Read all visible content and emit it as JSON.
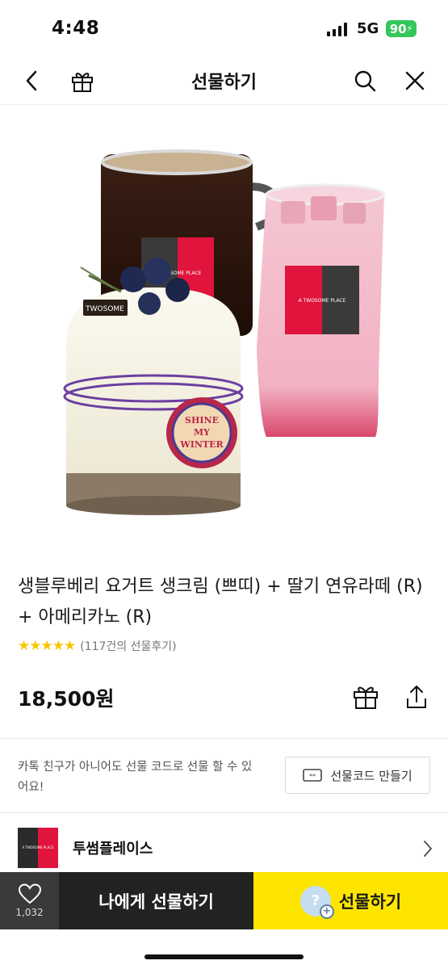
{
  "status_bar": {
    "time": "4:48",
    "network": "5G",
    "battery": "90"
  },
  "header": {
    "title": "선물하기"
  },
  "product": {
    "image_labels": {
      "brand_sign_mug": "A TWOSOME PLACE",
      "brand_sign_glass": "A TWOSOME PLACE",
      "cake_tag": "TWOSOME",
      "badge_line1": "SHINE",
      "badge_line2": "MY",
      "badge_line3": "WINTER"
    },
    "title": "생블루베리 요거트 생크림 (쁘띠) + 딸기 연유라떼 (R) + 아메리카노 (R)",
    "stars": "★★★★★",
    "rating_count": "(117건의 선물후기)",
    "price": "18,500원"
  },
  "gift_code": {
    "info": "카톡 친구가 아니어도 선물 코드로 선물 할 수 있어요!",
    "button": "선물코드 만들기"
  },
  "brand": {
    "logo_text": "A TWOSOME PLACE",
    "name": "투썸플레이스"
  },
  "bottom_bar": {
    "like_count": "1,032",
    "self_gift": "나에게 선물하기",
    "gift": "선물하기",
    "gift_icon_glyph": "?",
    "gift_icon_plus": "+"
  },
  "colors": {
    "gift_button": "#fee500",
    "dark_button": "#222222",
    "star": "#f7c600",
    "brand_red": "#e0143c"
  }
}
